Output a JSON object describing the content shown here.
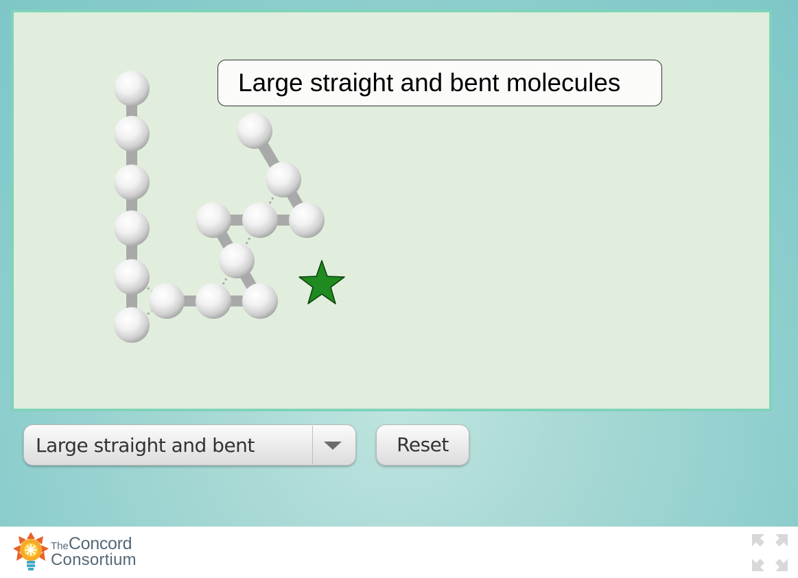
{
  "simulation": {
    "title": "Large straight and bent molecules"
  },
  "controls": {
    "molecule_select": {
      "selected": "Large straight and bent"
    },
    "reset_label": "Reset"
  },
  "footer": {
    "logo_the": "The",
    "logo_concord": "Concord",
    "logo_consortium": "Consortium",
    "fullscreen_icon": "fullscreen-icon"
  },
  "colors": {
    "frame_border": "#7fd3bb",
    "sim_background": "#e1eedd",
    "star": "#1f8a1f",
    "bond": "#a9a9a9",
    "logo_orange": "#e8622a"
  }
}
